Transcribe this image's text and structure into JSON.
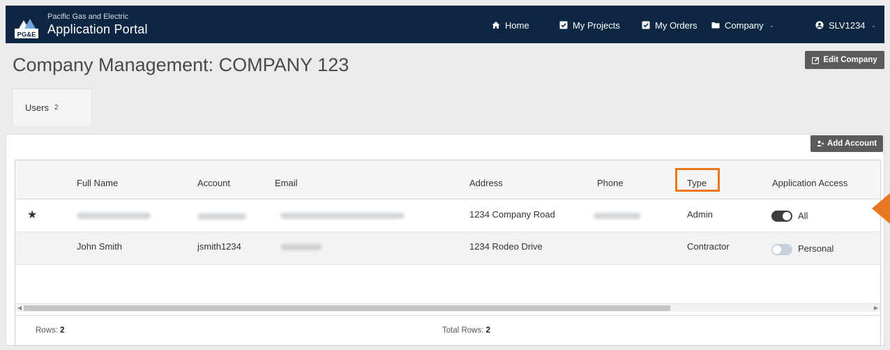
{
  "brand": {
    "small": "Pacific Gas and Electric",
    "title": "Application Portal",
    "logo_text": "PG&E"
  },
  "nav": {
    "home": "Home",
    "projects": "My Projects",
    "orders": "My Orders",
    "company": "Company",
    "user": "SLV1234"
  },
  "page": {
    "title": "Company Management: COMPANY 123",
    "edit_button": "Edit Company"
  },
  "tabs": [
    {
      "label": "Users",
      "count": "2"
    }
  ],
  "table": {
    "add_button": "Add Account",
    "columns": [
      "Full Name",
      "Account",
      "Email",
      "Address",
      "Phone",
      "Type",
      "Application Access"
    ],
    "rows": [
      {
        "starred": true,
        "full_name": "",
        "account": "",
        "email": "",
        "address": "1234 Company Road",
        "phone": "",
        "type": "Admin",
        "access": "All",
        "access_enabled": true
      },
      {
        "starred": false,
        "full_name": "John Smith",
        "account": "jsmith1234",
        "email": "",
        "address": "1234 Rodeo Drive",
        "phone": "",
        "type": "Contractor",
        "access": "Personal",
        "access_enabled": false
      }
    ],
    "footer": {
      "rows_label": "Rows:",
      "rows_value": "2",
      "total_label": "Total Rows:",
      "total_value": "2"
    }
  },
  "colors": {
    "nav_bg": "#0d2742",
    "highlight": "#e87722",
    "button_bg": "#5b5b5b",
    "toggle_on": "#3d3d3d",
    "toggle_off": "#c7d0db"
  }
}
